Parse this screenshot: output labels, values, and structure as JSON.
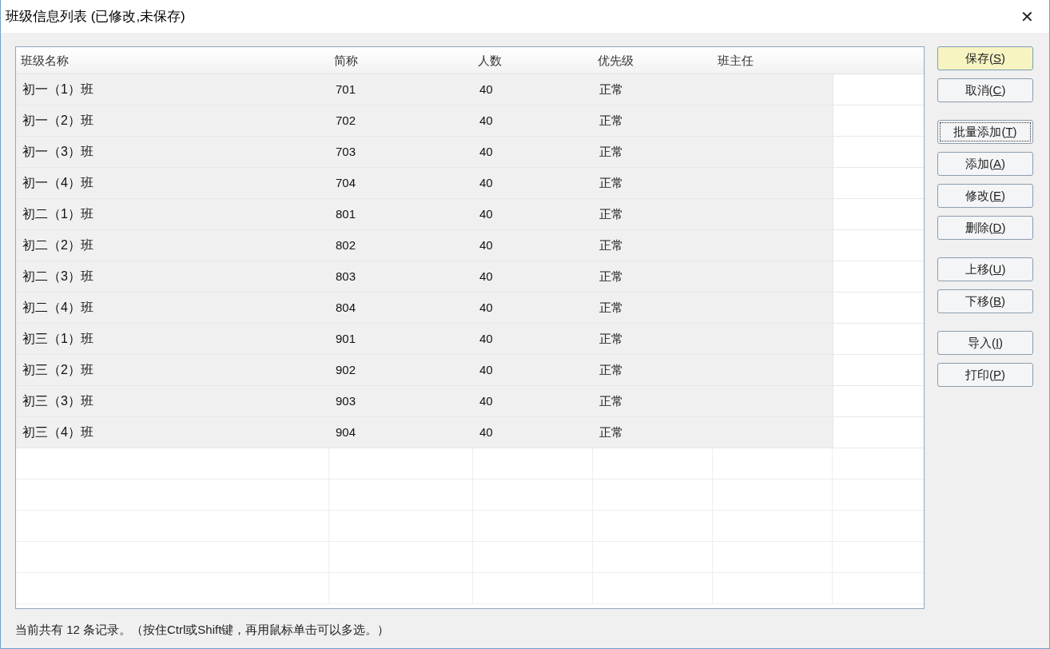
{
  "window": {
    "title": "班级信息列表 (已修改,未保存)",
    "close": "✕"
  },
  "table": {
    "columns": [
      "班级名称",
      "简称",
      "人数",
      "优先级",
      "班主任"
    ],
    "rows": [
      [
        "初一（1）班",
        "701",
        "40",
        "正常",
        ""
      ],
      [
        "初一（2）班",
        "702",
        "40",
        "正常",
        ""
      ],
      [
        "初一（3）班",
        "703",
        "40",
        "正常",
        ""
      ],
      [
        "初一（4）班",
        "704",
        "40",
        "正常",
        ""
      ],
      [
        "初二（1）班",
        "801",
        "40",
        "正常",
        ""
      ],
      [
        "初二（2）班",
        "802",
        "40",
        "正常",
        ""
      ],
      [
        "初二（3）班",
        "803",
        "40",
        "正常",
        ""
      ],
      [
        "初二（4）班",
        "804",
        "40",
        "正常",
        ""
      ],
      [
        "初三（1）班",
        "901",
        "40",
        "正常",
        ""
      ],
      [
        "初三（2）班",
        "902",
        "40",
        "正常",
        ""
      ],
      [
        "初三（3）班",
        "903",
        "40",
        "正常",
        ""
      ],
      [
        "初三（4）班",
        "904",
        "40",
        "正常",
        ""
      ]
    ]
  },
  "button_groups": [
    [
      {
        "label": "保存(S)",
        "default": true,
        "focused": false
      },
      {
        "label": "取消(C)",
        "default": false,
        "focused": false
      }
    ],
    [
      {
        "label": "批量添加(T)",
        "default": false,
        "focused": true
      },
      {
        "label": "添加(A)",
        "default": false,
        "focused": false
      },
      {
        "label": "修改(E)",
        "default": false,
        "focused": false
      },
      {
        "label": "删除(D)",
        "default": false,
        "focused": false
      }
    ],
    [
      {
        "label": "上移(U)",
        "default": false,
        "focused": false
      },
      {
        "label": "下移(B)",
        "default": false,
        "focused": false
      }
    ],
    [
      {
        "label": "导入(I)",
        "default": false,
        "focused": false
      },
      {
        "label": "打印(P)",
        "default": false,
        "focused": false
      }
    ]
  ],
  "status_bar": "当前共有 12 条记录。（按住Ctrl或Shift键，再用鼠标单击可以多选。）"
}
